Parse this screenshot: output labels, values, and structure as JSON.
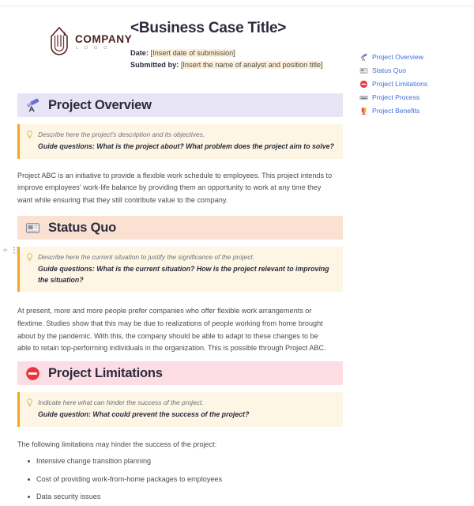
{
  "document": {
    "logo": {
      "company": "COMPANY",
      "sub": "L O G O",
      "icon": "company-building-logo-icon",
      "color": "#4a1f21"
    },
    "title": "<Business Case Title>",
    "meta": [
      {
        "label": "Date:",
        "value": "[Insert date of submission]"
      },
      {
        "label": "Submitted by:",
        "value": "[Insert the name of analyst and position title]"
      }
    ]
  },
  "toc": {
    "items": [
      {
        "label": "Project Overview",
        "icon": "telescope-icon"
      },
      {
        "label": "Status Quo",
        "icon": "newspaper-icon"
      },
      {
        "label": "Project Limitations",
        "icon": "no-entry-icon"
      },
      {
        "label": "Project Process",
        "icon": "keyboard-icon"
      },
      {
        "label": "Project Benefits",
        "icon": "trophy-icon"
      }
    ],
    "link_color": "#3a6fd8"
  },
  "sections": [
    {
      "id": "project-overview",
      "title": "Project Overview",
      "icon": "telescope-icon",
      "header_color": "#e6e4f5",
      "callout": {
        "icon": "lightbulb-icon",
        "hint": "Describe here the project's description and its objectives.",
        "guide": "Guide questions: What is the project about? What problem does the project aim to solve?"
      },
      "body": "Project ABC is an initiative to provide a flexible work schedule to employees. This project intends to improve employees' work-life balance by providing them an opportunity to work at any time they want while ensuring that they still contribute value to the company."
    },
    {
      "id": "status-quo",
      "title": "Status Quo",
      "icon": "newspaper-icon",
      "header_color": "#fbe1d2",
      "callout": {
        "icon": "lightbulb-icon",
        "hint": "Describe here the current situation to justify the significance of the project.",
        "guide": "Guide questions: What is the current situation? How is the project relevant to improving the situation?"
      },
      "body": "At present, more and more people prefer companies who offer flexible work arrangements or flextime. Studies show that this may be due to realizations of people working from home brought about by the pandemic. With this, the company should be able to adapt to these changes to be able to retain top-performing individuals in the organization. This is possible through Project ABC."
    },
    {
      "id": "project-limitations",
      "title": "Project Limitations",
      "icon": "no-entry-icon",
      "header_color": "#fcdde4",
      "callout": {
        "icon": "lightbulb-icon",
        "hint": "Indicate here what can hinder the success of the project.",
        "guide": "Guide question: What could prevent the success of the project?"
      },
      "lead": "The following limitations may hinder the success of the project:",
      "bullets": [
        "Intensive change transition planning",
        "Cost of providing work-from-home packages to employees",
        "Data security issues"
      ]
    }
  ],
  "gutter": {
    "add": "+",
    "drag": "drag-handle"
  }
}
